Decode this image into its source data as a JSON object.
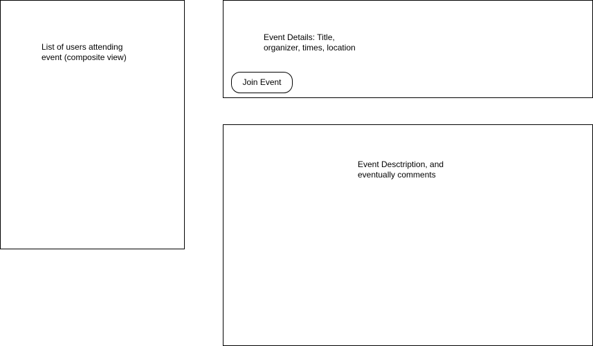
{
  "attendees_panel": {
    "lines": [
      "List of users attending",
      "event (composite view)"
    ]
  },
  "details_panel": {
    "lines": [
      "Event Details: Title,",
      "organizer, times, location"
    ],
    "join_button_label": "Join Event"
  },
  "description_panel": {
    "lines": [
      "Event Desctription, and",
      "eventually comments"
    ]
  }
}
